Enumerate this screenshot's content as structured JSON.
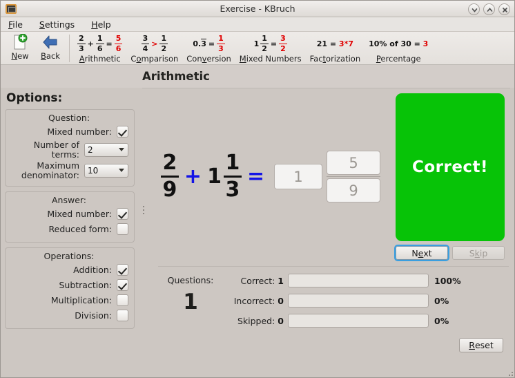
{
  "window": {
    "title": "Exercise - KBruch",
    "icon": "blackboard-icon",
    "buttons": {
      "minimize": "▾",
      "maximize": "▴",
      "close": "✕"
    }
  },
  "menubar": {
    "items": [
      {
        "label": "File",
        "mnemonic": "F"
      },
      {
        "label": "Settings",
        "mnemonic": "S"
      },
      {
        "label": "Help",
        "mnemonic": "H"
      }
    ]
  },
  "toolbar": {
    "new_label": "New",
    "new_mnemonic": "N",
    "back_label": "Back",
    "back_mnemonic": "B",
    "modes": [
      {
        "label": "Arithmetic",
        "mnemonic": "A",
        "formula": {
          "type": "two-fractions",
          "a_num": "2",
          "a_den": "3",
          "op": "+",
          "b_num": "1",
          "b_den": "6",
          "eq": "=",
          "r_num": "5",
          "r_den": "6"
        }
      },
      {
        "label": "Comparison",
        "mnemonic": "o",
        "formula": {
          "type": "compare",
          "a_num": "3",
          "a_den": "4",
          "op": ">",
          "b_num": "1",
          "b_den": "2"
        }
      },
      {
        "label": "Conversion",
        "mnemonic": "v",
        "formula": {
          "type": "decimal",
          "decimal": "0.3",
          "eq": "=",
          "r_num": "1",
          "r_den": "3"
        }
      },
      {
        "label": "Mixed Numbers",
        "mnemonic": "M",
        "formula": {
          "type": "mixed",
          "whole": "1",
          "a_num": "1",
          "a_den": "2",
          "eq": "=",
          "r_num": "3",
          "r_den": "2"
        }
      },
      {
        "label": "Factorization",
        "mnemonic": "t",
        "formula": {
          "type": "text",
          "left": "21 = ",
          "right": "3*7"
        }
      },
      {
        "label": "Percentage",
        "mnemonic": "P",
        "formula": {
          "type": "text",
          "left": "10% of 30 = ",
          "right": "3"
        }
      }
    ]
  },
  "page": {
    "title": "Arithmetic"
  },
  "options": {
    "heading": "Options:",
    "question": {
      "title": "Question:",
      "mixed_number_label": "Mixed number:",
      "mixed_number_checked": true,
      "terms_label": "Number of terms:",
      "terms_value": "2",
      "max_denominator_label_line1": "Maximum",
      "max_denominator_label_line2": "denominator:",
      "max_denominator_value": "10"
    },
    "answer": {
      "title": "Answer:",
      "mixed_number_label": "Mixed number:",
      "mixed_number_checked": true,
      "reduced_form_label": "Reduced form:",
      "reduced_form_checked": false
    },
    "operations": {
      "title": "Operations:",
      "addition_label": "Addition:",
      "addition_checked": true,
      "subtraction_label": "Subtraction:",
      "subtraction_checked": true,
      "multiplication_label": "Multiplication:",
      "multiplication_checked": false,
      "division_label": "Division:",
      "division_checked": false
    }
  },
  "exercise": {
    "term1": {
      "numerator": "2",
      "denominator": "9"
    },
    "operator": "+",
    "term2": {
      "whole": "1",
      "numerator": "1",
      "denominator": "3"
    },
    "equals": "=",
    "answer": {
      "integer": "1",
      "numerator": "5",
      "denominator": "9"
    }
  },
  "result": {
    "text": "Correct!",
    "color": "#07c307",
    "next_label": "Next",
    "next_mnemonic": "e",
    "skip_label": "Skip",
    "skip_mnemonic": "k",
    "skip_disabled": true
  },
  "statistics": {
    "questions_label": "Questions:",
    "questions_value": "1",
    "rows": [
      {
        "name": "Correct:",
        "count": "1",
        "percent": "100%",
        "fill": 100,
        "color": "#17dd17"
      },
      {
        "name": "Incorrect:",
        "count": "0",
        "percent": "0%",
        "fill": 0,
        "color": "#dd8a8a"
      },
      {
        "name": "Skipped:",
        "count": "0",
        "percent": "0%",
        "fill": 0,
        "color": "#c2c49a"
      }
    ],
    "reset_label": "Reset",
    "reset_mnemonic": "R"
  }
}
